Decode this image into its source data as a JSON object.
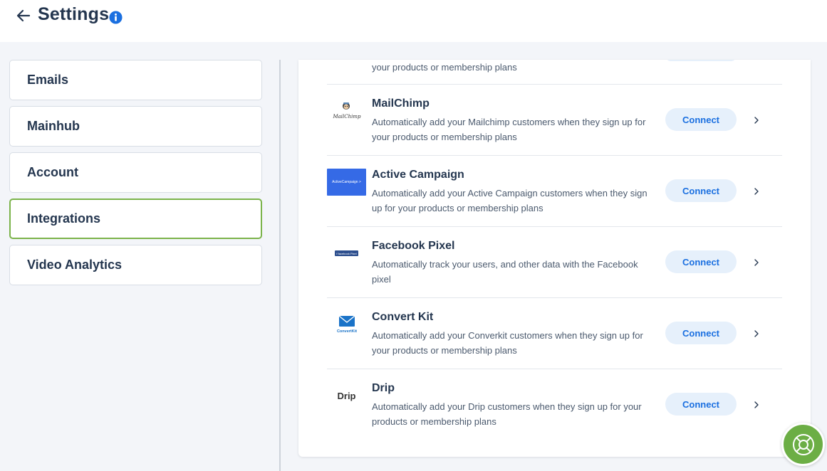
{
  "header": {
    "title": "Settings"
  },
  "sidebar": {
    "items": [
      {
        "label": "Emails",
        "active": false
      },
      {
        "label": "Mainhub",
        "active": false
      },
      {
        "label": "Account",
        "active": false
      },
      {
        "label": "Integrations",
        "active": true
      },
      {
        "label": "Video Analytics",
        "active": false
      }
    ]
  },
  "integrations": {
    "partial_description": "your products or membership plans",
    "connect_label": "Connect",
    "rows": [
      {
        "name": "MailChimp",
        "description": "Automatically add your Mailchimp customers when they sign up for your products or membership plans",
        "logo": "mailchimp-logo",
        "logo_text": "MailChimp"
      },
      {
        "name": "Active Campaign",
        "description": "Automatically add your Active Campaign customers when they sign up for your products or membership plans",
        "logo": "activecampaign-logo",
        "logo_text": "ActiveCampaign >"
      },
      {
        "name": "Facebook Pixel",
        "description": "Automatically track your users, and other data with the Facebook pixel",
        "logo": "facebook-pixel-logo",
        "logo_text": "f facebook Pixel"
      },
      {
        "name": "Convert Kit",
        "description": "Automatically add your Converkit customers when they sign up for your products or membership plans",
        "logo": "convertkit-logo",
        "logo_text": "ConvertKit"
      },
      {
        "name": "Drip",
        "description": "Automatically add your Drip customers when they sign up for your products or membership plans",
        "logo": "drip-logo",
        "logo_text": "Drip"
      }
    ]
  },
  "colors": {
    "accent_green": "#6cae45",
    "active_border": "#7bb34a",
    "connect_text": "#1a6fe0",
    "connect_bg": "#e6f0fb",
    "info_blue": "#1a6fe0",
    "title_text": "#24364f"
  },
  "icons": {
    "back": "arrow-left-icon",
    "info": "info-icon",
    "chevron": "chevron-right-icon",
    "help": "lifebuoy-icon"
  }
}
